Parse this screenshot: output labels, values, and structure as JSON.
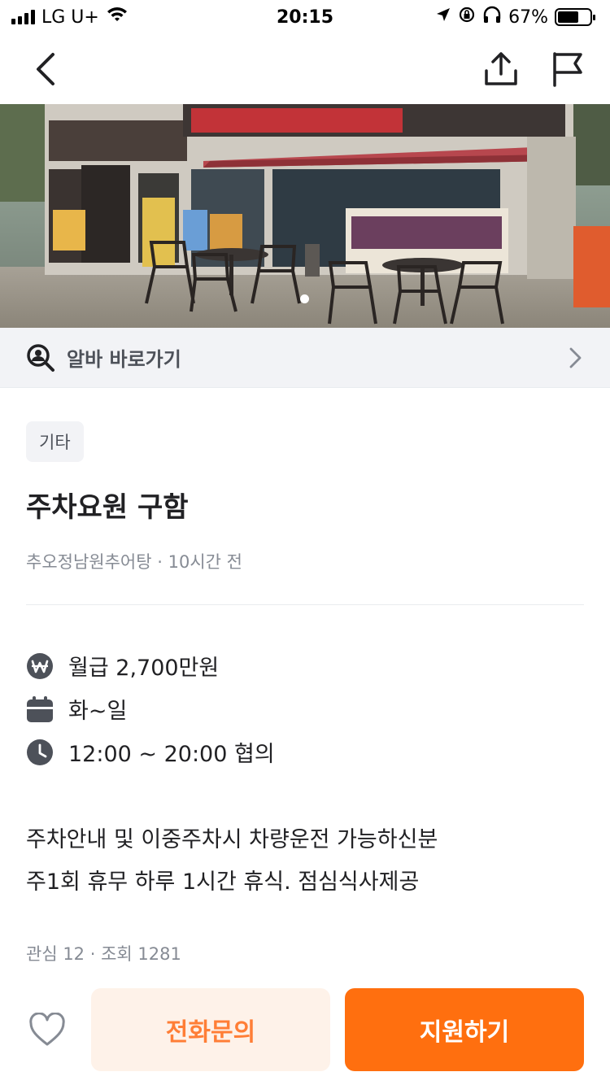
{
  "status_bar": {
    "carrier": "LG U+",
    "time": "20:15",
    "battery_text": "67%",
    "battery_level": 0.67
  },
  "icons": {
    "back": "chevron-left-icon",
    "share": "share-icon",
    "report": "flag-icon",
    "alba_search": "search-person-icon",
    "alba_arrow": "chevron-right-icon",
    "salary": "won-icon",
    "calendar": "calendar-icon",
    "clock": "clock-icon",
    "like": "heart-icon"
  },
  "alba_link": {
    "label": "알바 바로가기"
  },
  "post": {
    "tag": "기타",
    "title": "주차요원 구함",
    "store": "추오정남원추어탕",
    "separator": " · ",
    "time_ago": "10시간 전"
  },
  "info": [
    {
      "icon": "won-icon",
      "text": "월급 2,700만원"
    },
    {
      "icon": "calendar-icon",
      "text": "화~일"
    },
    {
      "icon": "clock-icon",
      "text": "12:00 ~ 20:00 협의"
    }
  ],
  "description": [
    "주차안내 및 이중주차시 차량운전 가능하신분",
    "주1회 휴무 하루 1시간 휴식. 점심식사제공"
  ],
  "stats": {
    "text": "관심 12 · 조회 1281"
  },
  "actions": {
    "call_label": "전화문의",
    "apply_label": "지원하기"
  },
  "colors": {
    "accent": "#ff6f0f",
    "accent_light": "#fef2e9",
    "accent_text": "#ff7e36",
    "muted_text": "#868b94",
    "icon_gray": "#4d5159"
  }
}
